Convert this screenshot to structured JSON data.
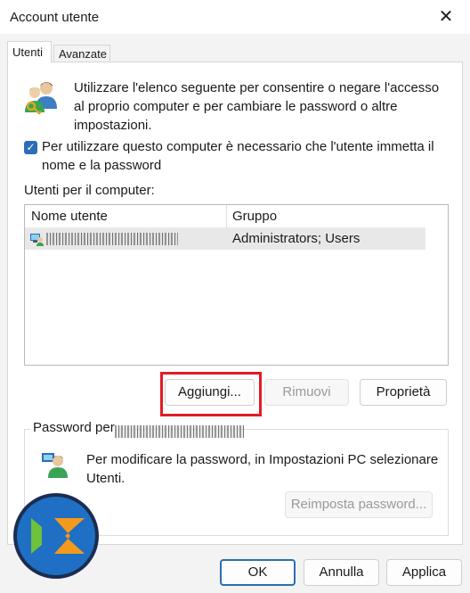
{
  "window": {
    "title": "Account utente",
    "close_glyph": "✕"
  },
  "tabs": [
    {
      "label": "Utenti",
      "active": true
    },
    {
      "label": "Avanzate",
      "active": false
    }
  ],
  "intro": {
    "icon": "users-icon",
    "text": "Utilizzare l'elenco seguente per consentire o negare l'accesso al proprio computer e per cambiare le password o altre impostazioni."
  },
  "require_login": {
    "checked": true,
    "label": "Per utilizzare questo computer è necessario che l'utente immetta il nome e la password"
  },
  "users_list": {
    "label": "Utenti per il computer:",
    "columns": [
      "Nome utente",
      "Gruppo"
    ],
    "rows": [
      {
        "name_redacted": true,
        "group": "Administrators; Users"
      }
    ]
  },
  "buttons": {
    "add": "Aggiungi...",
    "remove": "Rimuovi",
    "properties": "Proprietà",
    "reset_password": "Reimposta password...",
    "ok": "OK",
    "cancel": "Annulla",
    "apply": "Applica"
  },
  "password_group": {
    "label_prefix": "Password per",
    "text": "Per modificare la password, in Impostazioni PC selezionare Utenti."
  },
  "colors": {
    "accent": "#2a6fb5",
    "highlight": "#e21b24"
  }
}
